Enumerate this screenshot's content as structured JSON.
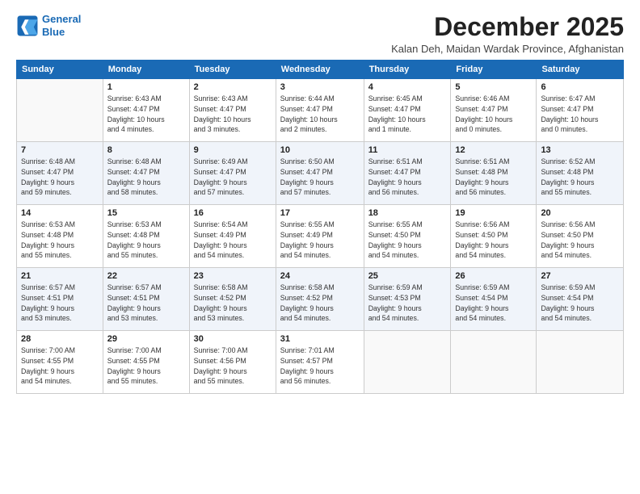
{
  "logo": {
    "line1": "General",
    "line2": "Blue"
  },
  "title": "December 2025",
  "subtitle": "Kalan Deh, Maidan Wardak Province, Afghanistan",
  "days_header": [
    "Sunday",
    "Monday",
    "Tuesday",
    "Wednesday",
    "Thursday",
    "Friday",
    "Saturday"
  ],
  "weeks": [
    [
      {
        "day": "",
        "info": ""
      },
      {
        "day": "1",
        "info": "Sunrise: 6:43 AM\nSunset: 4:47 PM\nDaylight: 10 hours\nand 4 minutes."
      },
      {
        "day": "2",
        "info": "Sunrise: 6:43 AM\nSunset: 4:47 PM\nDaylight: 10 hours\nand 3 minutes."
      },
      {
        "day": "3",
        "info": "Sunrise: 6:44 AM\nSunset: 4:47 PM\nDaylight: 10 hours\nand 2 minutes."
      },
      {
        "day": "4",
        "info": "Sunrise: 6:45 AM\nSunset: 4:47 PM\nDaylight: 10 hours\nand 1 minute."
      },
      {
        "day": "5",
        "info": "Sunrise: 6:46 AM\nSunset: 4:47 PM\nDaylight: 10 hours\nand 0 minutes."
      },
      {
        "day": "6",
        "info": "Sunrise: 6:47 AM\nSunset: 4:47 PM\nDaylight: 10 hours\nand 0 minutes."
      }
    ],
    [
      {
        "day": "7",
        "info": "Sunrise: 6:48 AM\nSunset: 4:47 PM\nDaylight: 9 hours\nand 59 minutes."
      },
      {
        "day": "8",
        "info": "Sunrise: 6:48 AM\nSunset: 4:47 PM\nDaylight: 9 hours\nand 58 minutes."
      },
      {
        "day": "9",
        "info": "Sunrise: 6:49 AM\nSunset: 4:47 PM\nDaylight: 9 hours\nand 57 minutes."
      },
      {
        "day": "10",
        "info": "Sunrise: 6:50 AM\nSunset: 4:47 PM\nDaylight: 9 hours\nand 57 minutes."
      },
      {
        "day": "11",
        "info": "Sunrise: 6:51 AM\nSunset: 4:47 PM\nDaylight: 9 hours\nand 56 minutes."
      },
      {
        "day": "12",
        "info": "Sunrise: 6:51 AM\nSunset: 4:48 PM\nDaylight: 9 hours\nand 56 minutes."
      },
      {
        "day": "13",
        "info": "Sunrise: 6:52 AM\nSunset: 4:48 PM\nDaylight: 9 hours\nand 55 minutes."
      }
    ],
    [
      {
        "day": "14",
        "info": "Sunrise: 6:53 AM\nSunset: 4:48 PM\nDaylight: 9 hours\nand 55 minutes."
      },
      {
        "day": "15",
        "info": "Sunrise: 6:53 AM\nSunset: 4:48 PM\nDaylight: 9 hours\nand 55 minutes."
      },
      {
        "day": "16",
        "info": "Sunrise: 6:54 AM\nSunset: 4:49 PM\nDaylight: 9 hours\nand 54 minutes."
      },
      {
        "day": "17",
        "info": "Sunrise: 6:55 AM\nSunset: 4:49 PM\nDaylight: 9 hours\nand 54 minutes."
      },
      {
        "day": "18",
        "info": "Sunrise: 6:55 AM\nSunset: 4:50 PM\nDaylight: 9 hours\nand 54 minutes."
      },
      {
        "day": "19",
        "info": "Sunrise: 6:56 AM\nSunset: 4:50 PM\nDaylight: 9 hours\nand 54 minutes."
      },
      {
        "day": "20",
        "info": "Sunrise: 6:56 AM\nSunset: 4:50 PM\nDaylight: 9 hours\nand 54 minutes."
      }
    ],
    [
      {
        "day": "21",
        "info": "Sunrise: 6:57 AM\nSunset: 4:51 PM\nDaylight: 9 hours\nand 53 minutes."
      },
      {
        "day": "22",
        "info": "Sunrise: 6:57 AM\nSunset: 4:51 PM\nDaylight: 9 hours\nand 53 minutes."
      },
      {
        "day": "23",
        "info": "Sunrise: 6:58 AM\nSunset: 4:52 PM\nDaylight: 9 hours\nand 53 minutes."
      },
      {
        "day": "24",
        "info": "Sunrise: 6:58 AM\nSunset: 4:52 PM\nDaylight: 9 hours\nand 54 minutes."
      },
      {
        "day": "25",
        "info": "Sunrise: 6:59 AM\nSunset: 4:53 PM\nDaylight: 9 hours\nand 54 minutes."
      },
      {
        "day": "26",
        "info": "Sunrise: 6:59 AM\nSunset: 4:54 PM\nDaylight: 9 hours\nand 54 minutes."
      },
      {
        "day": "27",
        "info": "Sunrise: 6:59 AM\nSunset: 4:54 PM\nDaylight: 9 hours\nand 54 minutes."
      }
    ],
    [
      {
        "day": "28",
        "info": "Sunrise: 7:00 AM\nSunset: 4:55 PM\nDaylight: 9 hours\nand 54 minutes."
      },
      {
        "day": "29",
        "info": "Sunrise: 7:00 AM\nSunset: 4:55 PM\nDaylight: 9 hours\nand 55 minutes."
      },
      {
        "day": "30",
        "info": "Sunrise: 7:00 AM\nSunset: 4:56 PM\nDaylight: 9 hours\nand 55 minutes."
      },
      {
        "day": "31",
        "info": "Sunrise: 7:01 AM\nSunset: 4:57 PM\nDaylight: 9 hours\nand 56 minutes."
      },
      {
        "day": "",
        "info": ""
      },
      {
        "day": "",
        "info": ""
      },
      {
        "day": "",
        "info": ""
      }
    ]
  ]
}
